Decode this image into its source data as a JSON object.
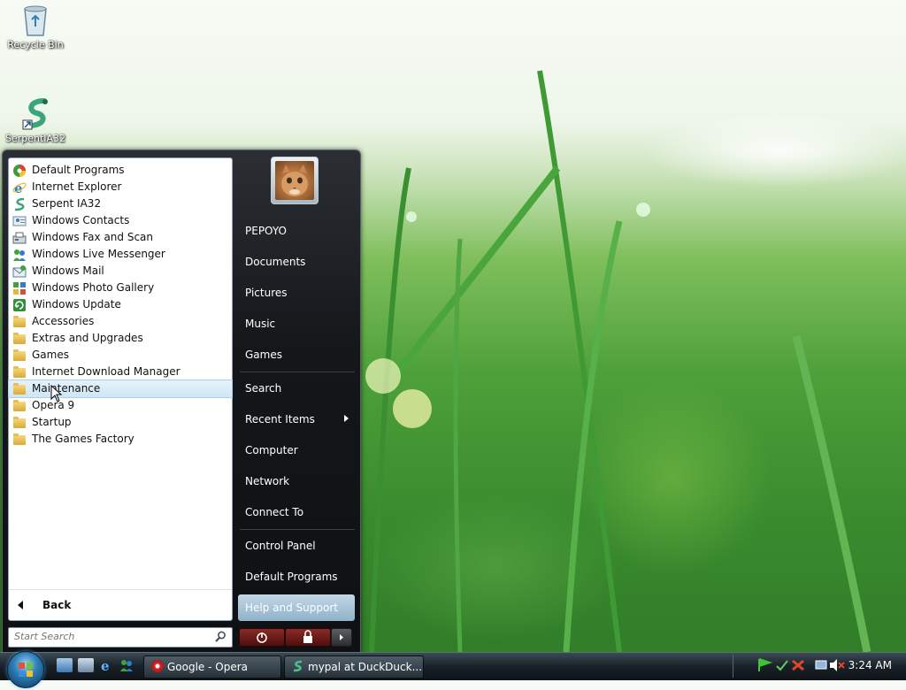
{
  "desktop": {
    "icons": [
      {
        "label": "Recycle Bin",
        "icon": "recycle-bin-icon"
      },
      {
        "label": "SerpentIA32",
        "icon": "serpent-icon"
      }
    ]
  },
  "start_menu": {
    "programs": [
      {
        "label": "Default Programs",
        "icon": "default-programs-icon"
      },
      {
        "label": "Internet Explorer",
        "icon": "internet-explorer-icon"
      },
      {
        "label": "Serpent IA32",
        "icon": "serpent-icon"
      },
      {
        "label": "Windows Contacts",
        "icon": "contacts-icon"
      },
      {
        "label": "Windows Fax and Scan",
        "icon": "fax-icon"
      },
      {
        "label": "Windows Live Messenger",
        "icon": "messenger-icon"
      },
      {
        "label": "Windows Mail",
        "icon": "mail-icon"
      },
      {
        "label": "Windows Photo Gallery",
        "icon": "photo-gallery-icon"
      },
      {
        "label": "Windows Update",
        "icon": "update-icon"
      },
      {
        "label": "Accessories",
        "icon": "folder-icon"
      },
      {
        "label": "Extras and Upgrades",
        "icon": "folder-icon"
      },
      {
        "label": "Games",
        "icon": "folder-icon"
      },
      {
        "label": "Internet Download Manager",
        "icon": "folder-icon"
      },
      {
        "label": "Maintenance",
        "icon": "folder-icon",
        "selected": true
      },
      {
        "label": "Opera 9",
        "icon": "folder-icon"
      },
      {
        "label": "Startup",
        "icon": "folder-icon"
      },
      {
        "label": "The Games Factory",
        "icon": "folder-icon"
      }
    ],
    "back_label": "Back",
    "search_placeholder": "Start Search",
    "right_items": {
      "user": "PEPOYO",
      "documents": "Documents",
      "pictures": "Pictures",
      "music": "Music",
      "games": "Games",
      "search": "Search",
      "recent": "Recent Items",
      "computer": "Computer",
      "network": "Network",
      "connect": "Connect To",
      "control_panel": "Control Panel",
      "default_programs": "Default Programs",
      "help": "Help and Support"
    }
  },
  "taskbar": {
    "buttons": [
      {
        "label": "Google - Opera",
        "icon": "opera-icon"
      },
      {
        "label": "mypal at DuckDuck...",
        "icon": "mypal-icon"
      }
    ],
    "clock": "3:24 AM"
  }
}
